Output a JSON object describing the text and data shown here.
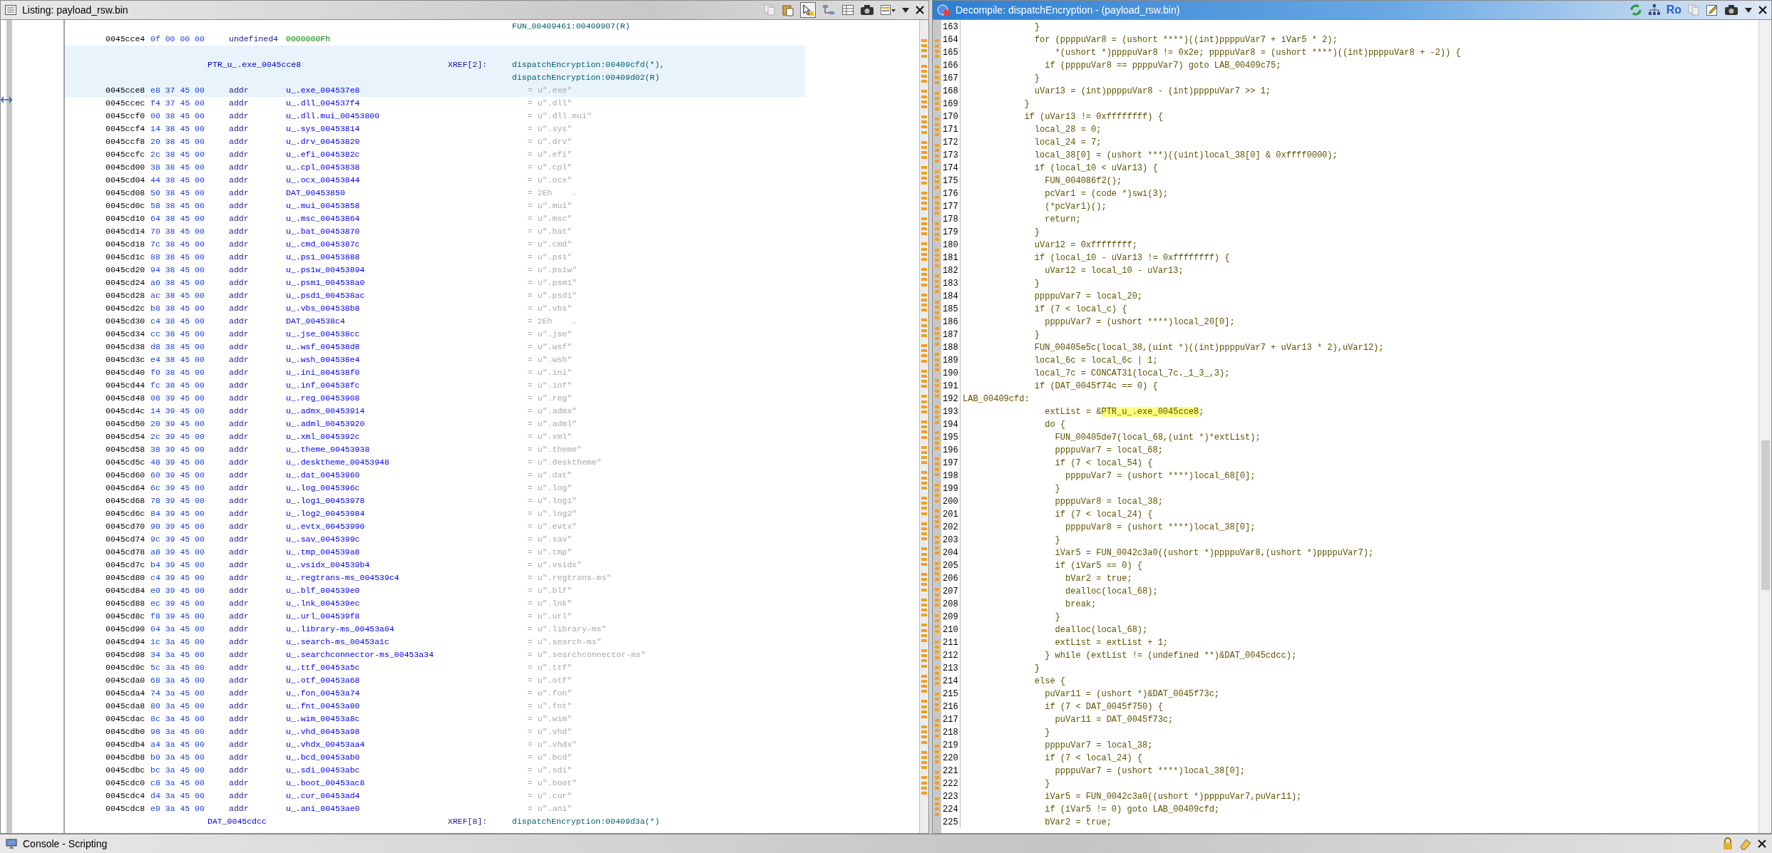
{
  "listing": {
    "title": "Listing:  payload_rsw.bin",
    "rows": [
      {
        "kind": "xref_cut",
        "xrefs": [
          "FUN_00409461:00409907(R)"
        ],
        "selected": false
      },
      {
        "kind": "data",
        "address": "0045cce4",
        "bytes": "0f 00 00 00",
        "mnemonic": "undefined4",
        "operand": "0000000Fh",
        "selected": false
      },
      {
        "kind": "label",
        "label": "PTR_u_.exe_0045cce8",
        "xref_label": "XREF[2]:",
        "xrefs": [
          "dispatchEncryption:00409cfd(*),",
          "dispatchEncryption:00409d02(R)"
        ],
        "selected": true
      },
      {
        "kind": "pointer",
        "address": "0045cce8",
        "bytes": "e8 37 45 00",
        "mnemonic": "addr",
        "operand": "u_.exe_004537e8",
        "value": "= u\".exe\"",
        "selected": true
      },
      {
        "kind": "pointer",
        "address": "0045ccec",
        "bytes": "f4 37 45 00",
        "mnemonic": "addr",
        "operand": "u_.dll_004537f4",
        "value": "= u\".dll\"",
        "selected": false
      },
      {
        "kind": "pointer",
        "address": "0045ccf0",
        "bytes": "00 38 45 00",
        "mnemonic": "addr",
        "operand": "u_.dll.mui_00453800",
        "value": "= u\".dll.mui\"",
        "selected": false
      },
      {
        "kind": "pointer",
        "address": "0045ccf4",
        "bytes": "14 38 45 00",
        "mnemonic": "addr",
        "operand": "u_.sys_00453814",
        "value": "= u\".sys\"",
        "selected": false
      },
      {
        "kind": "pointer",
        "address": "0045ccf8",
        "bytes": "20 38 45 00",
        "mnemonic": "addr",
        "operand": "u_.drv_00453820",
        "value": "= u\".drv\"",
        "selected": false
      },
      {
        "kind": "pointer",
        "address": "0045ccfc",
        "bytes": "2c 38 45 00",
        "mnemonic": "addr",
        "operand": "u_.efi_0045382c",
        "value": "= u\".efi\"",
        "selected": false
      },
      {
        "kind": "pointer",
        "address": "0045cd00",
        "bytes": "38 38 45 00",
        "mnemonic": "addr",
        "operand": "u_.cpl_00453838",
        "value": "= u\".cpl\"",
        "selected": false
      },
      {
        "kind": "pointer",
        "address": "0045cd04",
        "bytes": "44 38 45 00",
        "mnemonic": "addr",
        "operand": "u_.ocx_00453844",
        "value": "= u\".ocx\"",
        "selected": false
      },
      {
        "kind": "pointer",
        "address": "0045cd08",
        "bytes": "50 38 45 00",
        "mnemonic": "addr",
        "operand": "DAT_00453850",
        "value": "= 2Eh    .",
        "selected": false
      },
      {
        "kind": "pointer",
        "address": "0045cd0c",
        "bytes": "58 38 45 00",
        "mnemonic": "addr",
        "operand": "u_.mui_00453858",
        "value": "= u\".mui\"",
        "selected": false
      },
      {
        "kind": "pointer",
        "address": "0045cd10",
        "bytes": "64 38 45 00",
        "mnemonic": "addr",
        "operand": "u_.msc_00453864",
        "value": "= u\".msc\"",
        "selected": false
      },
      {
        "kind": "pointer",
        "address": "0045cd14",
        "bytes": "70 38 45 00",
        "mnemonic": "addr",
        "operand": "u_.bat_00453870",
        "value": "= u\".bat\"",
        "selected": false
      },
      {
        "kind": "pointer",
        "address": "0045cd18",
        "bytes": "7c 38 45 00",
        "mnemonic": "addr",
        "operand": "u_.cmd_0045387c",
        "value": "= u\".cmd\"",
        "selected": false
      },
      {
        "kind": "pointer",
        "address": "0045cd1c",
        "bytes": "88 38 45 00",
        "mnemonic": "addr",
        "operand": "u_.ps1_00453888",
        "value": "= u\".ps1\"",
        "selected": false
      },
      {
        "kind": "pointer",
        "address": "0045cd20",
        "bytes": "94 38 45 00",
        "mnemonic": "addr",
        "operand": "u_.ps1w_00453894",
        "value": "= u\".ps1w\"",
        "selected": false
      },
      {
        "kind": "pointer",
        "address": "0045cd24",
        "bytes": "a0 38 45 00",
        "mnemonic": "addr",
        "operand": "u_.psm1_004538a0",
        "value": "= u\".psm1\"",
        "selected": false
      },
      {
        "kind": "pointer",
        "address": "0045cd28",
        "bytes": "ac 38 45 00",
        "mnemonic": "addr",
        "operand": "u_.psd1_004538ac",
        "value": "= u\".psd1\"",
        "selected": false
      },
      {
        "kind": "pointer",
        "address": "0045cd2c",
        "bytes": "b8 38 45 00",
        "mnemonic": "addr",
        "operand": "u_.vbs_004538b8",
        "value": "= u\".vbs\"",
        "selected": false
      },
      {
        "kind": "pointer",
        "address": "0045cd30",
        "bytes": "c4 38 45 00",
        "mnemonic": "addr",
        "operand": "DAT_004538c4",
        "value": "= 2Eh    .",
        "selected": false
      },
      {
        "kind": "pointer",
        "address": "0045cd34",
        "bytes": "cc 38 45 00",
        "mnemonic": "addr",
        "operand": "u_.jse_004538cc",
        "value": "= u\".jse\"",
        "selected": false
      },
      {
        "kind": "pointer",
        "address": "0045cd38",
        "bytes": "d8 38 45 00",
        "mnemonic": "addr",
        "operand": "u_.wsf_004538d8",
        "value": "= u\".wsf\"",
        "selected": false
      },
      {
        "kind": "pointer",
        "address": "0045cd3c",
        "bytes": "e4 38 45 00",
        "mnemonic": "addr",
        "operand": "u_.wsh_004538e4",
        "value": "= u\".wsh\"",
        "selected": false
      },
      {
        "kind": "pointer",
        "address": "0045cd40",
        "bytes": "f0 38 45 00",
        "mnemonic": "addr",
        "operand": "u_.ini_004538f0",
        "value": "= u\".ini\"",
        "selected": false
      },
      {
        "kind": "pointer",
        "address": "0045cd44",
        "bytes": "fc 38 45 00",
        "mnemonic": "addr",
        "operand": "u_.inf_004538fc",
        "value": "= u\".inf\"",
        "selected": false
      },
      {
        "kind": "pointer",
        "address": "0045cd48",
        "bytes": "08 39 45 00",
        "mnemonic": "addr",
        "operand": "u_.reg_00453908",
        "value": "= u\".reg\"",
        "selected": false
      },
      {
        "kind": "pointer",
        "address": "0045cd4c",
        "bytes": "14 39 45 00",
        "mnemonic": "addr",
        "operand": "u_.admx_00453914",
        "value": "= u\".admx\"",
        "selected": false
      },
      {
        "kind": "pointer",
        "address": "0045cd50",
        "bytes": "20 39 45 00",
        "mnemonic": "addr",
        "operand": "u_.adml_00453920",
        "value": "= u\".adml\"",
        "selected": false
      },
      {
        "kind": "pointer",
        "address": "0045cd54",
        "bytes": "2c 39 45 00",
        "mnemonic": "addr",
        "operand": "u_.xml_0045392c",
        "value": "= u\".xml\"",
        "selected": false
      },
      {
        "kind": "pointer",
        "address": "0045cd58",
        "bytes": "38 39 45 00",
        "mnemonic": "addr",
        "operand": "u_.theme_00453938",
        "value": "= u\".theme\"",
        "selected": false
      },
      {
        "kind": "pointer",
        "address": "0045cd5c",
        "bytes": "48 39 45 00",
        "mnemonic": "addr",
        "operand": "u_.desktheme_00453948",
        "value": "= u\".desktheme\"",
        "selected": false
      },
      {
        "kind": "pointer",
        "address": "0045cd60",
        "bytes": "60 39 45 00",
        "mnemonic": "addr",
        "operand": "u_.dat_00453960",
        "value": "= u\".dat\"",
        "selected": false
      },
      {
        "kind": "pointer",
        "address": "0045cd64",
        "bytes": "6c 39 45 00",
        "mnemonic": "addr",
        "operand": "u_.log_0045396c",
        "value": "= u\".log\"",
        "selected": false
      },
      {
        "kind": "pointer",
        "address": "0045cd68",
        "bytes": "78 39 45 00",
        "mnemonic": "addr",
        "operand": "u_.log1_00453978",
        "value": "= u\".log1\"",
        "selected": false
      },
      {
        "kind": "pointer",
        "address": "0045cd6c",
        "bytes": "84 39 45 00",
        "mnemonic": "addr",
        "operand": "u_.log2_00453984",
        "value": "= u\".log2\"",
        "selected": false
      },
      {
        "kind": "pointer",
        "address": "0045cd70",
        "bytes": "90 39 45 00",
        "mnemonic": "addr",
        "operand": "u_.evtx_00453990",
        "value": "= u\".evtx\"",
        "selected": false
      },
      {
        "kind": "pointer",
        "address": "0045cd74",
        "bytes": "9c 39 45 00",
        "mnemonic": "addr",
        "operand": "u_.sav_0045399c",
        "value": "= u\".sav\"",
        "selected": false
      },
      {
        "kind": "pointer",
        "address": "0045cd78",
        "bytes": "a8 39 45 00",
        "mnemonic": "addr",
        "operand": "u_.tmp_004539a8",
        "value": "= u\".tmp\"",
        "selected": false
      },
      {
        "kind": "pointer",
        "address": "0045cd7c",
        "bytes": "b4 39 45 00",
        "mnemonic": "addr",
        "operand": "u_.vsidx_004539b4",
        "value": "= u\".vsidx\"",
        "selected": false
      },
      {
        "kind": "pointer",
        "address": "0045cd80",
        "bytes": "c4 39 45 00",
        "mnemonic": "addr",
        "operand": "u_.regtrans-ms_004539c4",
        "value": "= u\".regtrans-ms\"",
        "selected": false
      },
      {
        "kind": "pointer",
        "address": "0045cd84",
        "bytes": "e0 39 45 00",
        "mnemonic": "addr",
        "operand": "u_.blf_004539e0",
        "value": "= u\".blf\"",
        "selected": false
      },
      {
        "kind": "pointer",
        "address": "0045cd88",
        "bytes": "ec 39 45 00",
        "mnemonic": "addr",
        "operand": "u_.lnk_004539ec",
        "value": "= u\".lnk\"",
        "selected": false
      },
      {
        "kind": "pointer",
        "address": "0045cd8c",
        "bytes": "f8 39 45 00",
        "mnemonic": "addr",
        "operand": "u_.url_004539f8",
        "value": "= u\".url\"",
        "selected": false
      },
      {
        "kind": "pointer",
        "address": "0045cd90",
        "bytes": "04 3a 45 00",
        "mnemonic": "addr",
        "operand": "u_.library-ms_00453a04",
        "value": "= u\".library-ms\"",
        "selected": false
      },
      {
        "kind": "pointer",
        "address": "0045cd94",
        "bytes": "1c 3a 45 00",
        "mnemonic": "addr",
        "operand": "u_.search-ms_00453a1c",
        "value": "= u\".search-ms\"",
        "selected": false
      },
      {
        "kind": "pointer",
        "address": "0045cd98",
        "bytes": "34 3a 45 00",
        "mnemonic": "addr",
        "operand": "u_.searchconnector-ms_00453a34",
        "value": "= u\".searchconnector-ms\"",
        "selected": false
      },
      {
        "kind": "pointer",
        "address": "0045cd9c",
        "bytes": "5c 3a 45 00",
        "mnemonic": "addr",
        "operand": "u_.ttf_00453a5c",
        "value": "= u\".ttf\"",
        "selected": false
      },
      {
        "kind": "pointer",
        "address": "0045cda0",
        "bytes": "68 3a 45 00",
        "mnemonic": "addr",
        "operand": "u_.otf_00453a68",
        "value": "= u\".otf\"",
        "selected": false
      },
      {
        "kind": "pointer",
        "address": "0045cda4",
        "bytes": "74 3a 45 00",
        "mnemonic": "addr",
        "operand": "u_.fon_00453a74",
        "value": "= u\".fon\"",
        "selected": false
      },
      {
        "kind": "pointer",
        "address": "0045cda8",
        "bytes": "80 3a 45 00",
        "mnemonic": "addr",
        "operand": "u_.fnt_00453a80",
        "value": "= u\".fnt\"",
        "selected": false
      },
      {
        "kind": "pointer",
        "address": "0045cdac",
        "bytes": "8c 3a 45 00",
        "mnemonic": "addr",
        "operand": "u_.wim_00453a8c",
        "value": "= u\".wim\"",
        "selected": false
      },
      {
        "kind": "pointer",
        "address": "0045cdb0",
        "bytes": "98 3a 45 00",
        "mnemonic": "addr",
        "operand": "u_.vhd_00453a98",
        "value": "= u\".vhd\"",
        "selected": false
      },
      {
        "kind": "pointer",
        "address": "0045cdb4",
        "bytes": "a4 3a 45 00",
        "mnemonic": "addr",
        "operand": "u_.vhdx_00453aa4",
        "value": "= u\".vhdx\"",
        "selected": false
      },
      {
        "kind": "pointer",
        "address": "0045cdb8",
        "bytes": "b0 3a 45 00",
        "mnemonic": "addr",
        "operand": "u_.bcd_00453ab0",
        "value": "= u\".bcd\"",
        "selected": false
      },
      {
        "kind": "pointer",
        "address": "0045cdbc",
        "bytes": "bc 3a 45 00",
        "mnemonic": "addr",
        "operand": "u_.sdi_00453abc",
        "value": "= u\".sdi\"",
        "selected": false
      },
      {
        "kind": "pointer",
        "address": "0045cdc0",
        "bytes": "c8 3a 45 00",
        "mnemonic": "addr",
        "operand": "u_.boot_00453ac8",
        "value": "= u\".boot\"",
        "selected": false
      },
      {
        "kind": "pointer",
        "address": "0045cdc4",
        "bytes": "d4 3a 45 00",
        "mnemonic": "addr",
        "operand": "u_.cur_00453ad4",
        "value": "= u\".cur\"",
        "selected": false
      },
      {
        "kind": "pointer",
        "address": "0045cdc8",
        "bytes": "e0 3a 45 00",
        "mnemonic": "addr",
        "operand": "u_.ani_00453ae0",
        "value": "= u\".ani\"",
        "selected": false
      },
      {
        "kind": "label",
        "label": "DAT_0045cdcc",
        "xref_label": "XREF[8]:",
        "xrefs": [
          "dispatchEncryption:00409d3a(*)"
        ],
        "selected": false
      }
    ]
  },
  "decompile": {
    "title": "Decompile: dispatchEncryption -  (payload_rsw.bin)",
    "toolbar_text": "Ro",
    "lines": [
      {
        "number": "163",
        "text": "              }"
      },
      {
        "number": "164",
        "text": "              for (ppppuVar8 = (ushort ****)((int)ppppuVar7 + iVar5 * 2);"
      },
      {
        "number": "165",
        "text": "                  *(ushort *)ppppuVar8 != 0x2e; ppppuVar8 = (ushort ****)((int)ppppuVar8 + -2)) {"
      },
      {
        "number": "166",
        "text": "                if (ppppuVar8 == ppppuVar7) goto LAB_00409c75;"
      },
      {
        "number": "167",
        "text": "              }"
      },
      {
        "number": "168",
        "text": "              uVar13 = (int)ppppuVar8 - (int)ppppuVar7 >> 1;"
      },
      {
        "number": "169",
        "text": "            }"
      },
      {
        "number": "170",
        "text": "            if (uVar13 != 0xffffffff) {"
      },
      {
        "number": "171",
        "text": "              local_28 = 0;"
      },
      {
        "number": "172",
        "text": "              local_24 = 7;"
      },
      {
        "number": "173",
        "text": "              local_38[0] = (ushort ***)((uint)local_38[0] & 0xffff0000);"
      },
      {
        "number": "174",
        "text": "              if (local_10 < uVar13) {"
      },
      {
        "number": "175",
        "text": "                FUN_004086f2();"
      },
      {
        "number": "176",
        "text": "                pcVar1 = (code *)swi(3);"
      },
      {
        "number": "177",
        "text": "                (*pcVar1)();"
      },
      {
        "number": "178",
        "text": "                return;"
      },
      {
        "number": "179",
        "text": "              }"
      },
      {
        "number": "180",
        "text": "              uVar12 = 0xffffffff;"
      },
      {
        "number": "181",
        "text": "              if (local_10 - uVar13 != 0xffffffff) {"
      },
      {
        "number": "182",
        "text": "                uVar12 = local_10 - uVar13;"
      },
      {
        "number": "183",
        "text": "              }"
      },
      {
        "number": "184",
        "text": "              ppppuVar7 = local_20;"
      },
      {
        "number": "185",
        "text": "              if (7 < local_c) {"
      },
      {
        "number": "186",
        "text": "                ppppuVar7 = (ushort ****)local_20[0];"
      },
      {
        "number": "187",
        "text": "              }"
      },
      {
        "number": "188",
        "text": "              FUN_00405e5c(local_38,(uint *)((int)ppppuVar7 + uVar13 * 2),uVar12);"
      },
      {
        "number": "189",
        "text": "              local_6c = local_6c | 1;"
      },
      {
        "number": "190",
        "text": "              local_7c = CONCAT31(local_7c._1_3_,3);"
      },
      {
        "number": "191",
        "text": "              if (DAT_0045f74c == 0) {"
      },
      {
        "number": "192",
        "text": "LAB_00409cfd:"
      },
      {
        "number": "193",
        "segments": [
          {
            "text": "                extList = &",
            "highlighted": false
          },
          {
            "text": "PTR_u_.exe_0045cce8",
            "highlighted": true
          },
          {
            "text": ";",
            "highlighted": false
          }
        ]
      },
      {
        "number": "194",
        "text": "                do {"
      },
      {
        "number": "195",
        "text": "                  FUN_00405de7(local_68,(uint *)*extList);"
      },
      {
        "number": "196",
        "text": "                  ppppuVar7 = local_68;"
      },
      {
        "number": "197",
        "text": "                  if (7 < local_54) {"
      },
      {
        "number": "198",
        "text": "                    ppppuVar7 = (ushort ****)local_68[0];"
      },
      {
        "number": "199",
        "text": "                  }"
      },
      {
        "number": "200",
        "text": "                  ppppuVar8 = local_38;"
      },
      {
        "number": "201",
        "text": "                  if (7 < local_24) {"
      },
      {
        "number": "202",
        "text": "                    ppppuVar8 = (ushort ****)local_38[0];"
      },
      {
        "number": "203",
        "text": "                  }"
      },
      {
        "number": "204",
        "text": "                  iVar5 = FUN_0042c3a0((ushort *)ppppuVar8,(ushort *)ppppuVar7);"
      },
      {
        "number": "205",
        "text": "                  if (iVar5 == 0) {"
      },
      {
        "number": "206",
        "text": "                    bVar2 = true;"
      },
      {
        "number": "207",
        "text": "                    dealloc(local_68);"
      },
      {
        "number": "208",
        "text": "                    break;"
      },
      {
        "number": "209",
        "text": "                  }"
      },
      {
        "number": "210",
        "text": "                  dealloc(local_68);"
      },
      {
        "number": "211",
        "text": "                  extList = extList + 1;"
      },
      {
        "number": "212",
        "text": "                } while (extList != (undefined **)&DAT_0045cdcc);"
      },
      {
        "number": "213",
        "text": "              }"
      },
      {
        "number": "214",
        "text": "              else {"
      },
      {
        "number": "215",
        "text": "                puVar11 = (ushort *)&DAT_0045f73c;"
      },
      {
        "number": "216",
        "text": "                if (7 < DAT_0045f750) {"
      },
      {
        "number": "217",
        "text": "                  puVar11 = DAT_0045f73c;"
      },
      {
        "number": "218",
        "text": "                }"
      },
      {
        "number": "219",
        "text": "                ppppuVar7 = local_38;"
      },
      {
        "number": "220",
        "text": "                if (7 < local_24) {"
      },
      {
        "number": "221",
        "text": "                  ppppuVar7 = (ushort ****)local_38[0];"
      },
      {
        "number": "222",
        "text": "                }"
      },
      {
        "number": "223",
        "text": "                iVar5 = FUN_0042c3a0((ushort *)ppppuVar7,puVar11);"
      },
      {
        "number": "224",
        "text": "                if (iVar5 != 0) goto LAB_00409cfd;"
      },
      {
        "number": "225",
        "text": "                bVar2 = true;"
      }
    ]
  },
  "console": {
    "title": "Console - Scripting"
  }
}
